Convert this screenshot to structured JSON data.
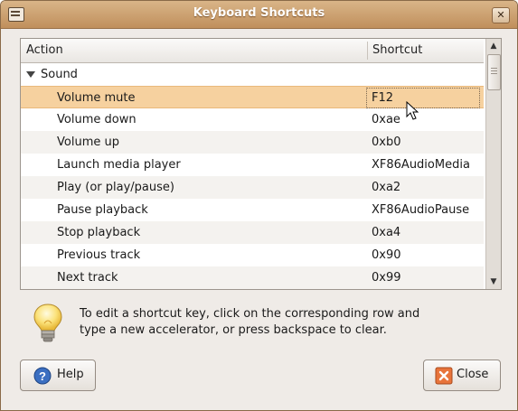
{
  "window": {
    "title": "Keyboard Shortcuts",
    "close_glyph": "✕"
  },
  "tree": {
    "columns": {
      "action": "Action",
      "shortcut": "Shortcut"
    },
    "group": {
      "label": "Sound",
      "expanded": true
    },
    "rows": [
      {
        "action": "Volume mute",
        "shortcut": "F12",
        "selected": true
      },
      {
        "action": "Volume down",
        "shortcut": "0xae"
      },
      {
        "action": "Volume up",
        "shortcut": "0xb0"
      },
      {
        "action": "Launch media player",
        "shortcut": "XF86AudioMedia"
      },
      {
        "action": "Play (or play/pause)",
        "shortcut": "0xa2"
      },
      {
        "action": "Pause playback",
        "shortcut": "XF86AudioPause"
      },
      {
        "action": "Stop playback",
        "shortcut": "0xa4"
      },
      {
        "action": "Previous track",
        "shortcut": "0x90"
      },
      {
        "action": "Next track",
        "shortcut": "0x99"
      }
    ]
  },
  "hint": {
    "text": "To edit a shortcut key, click on the corresponding row and type a new accelerator, or press backspace to clear."
  },
  "buttons": {
    "help_label": "Help",
    "close_label": "Close"
  },
  "colors": {
    "titlebar": "#c9a071",
    "selection": "#f6d19f",
    "window_bg": "#efebe7"
  }
}
